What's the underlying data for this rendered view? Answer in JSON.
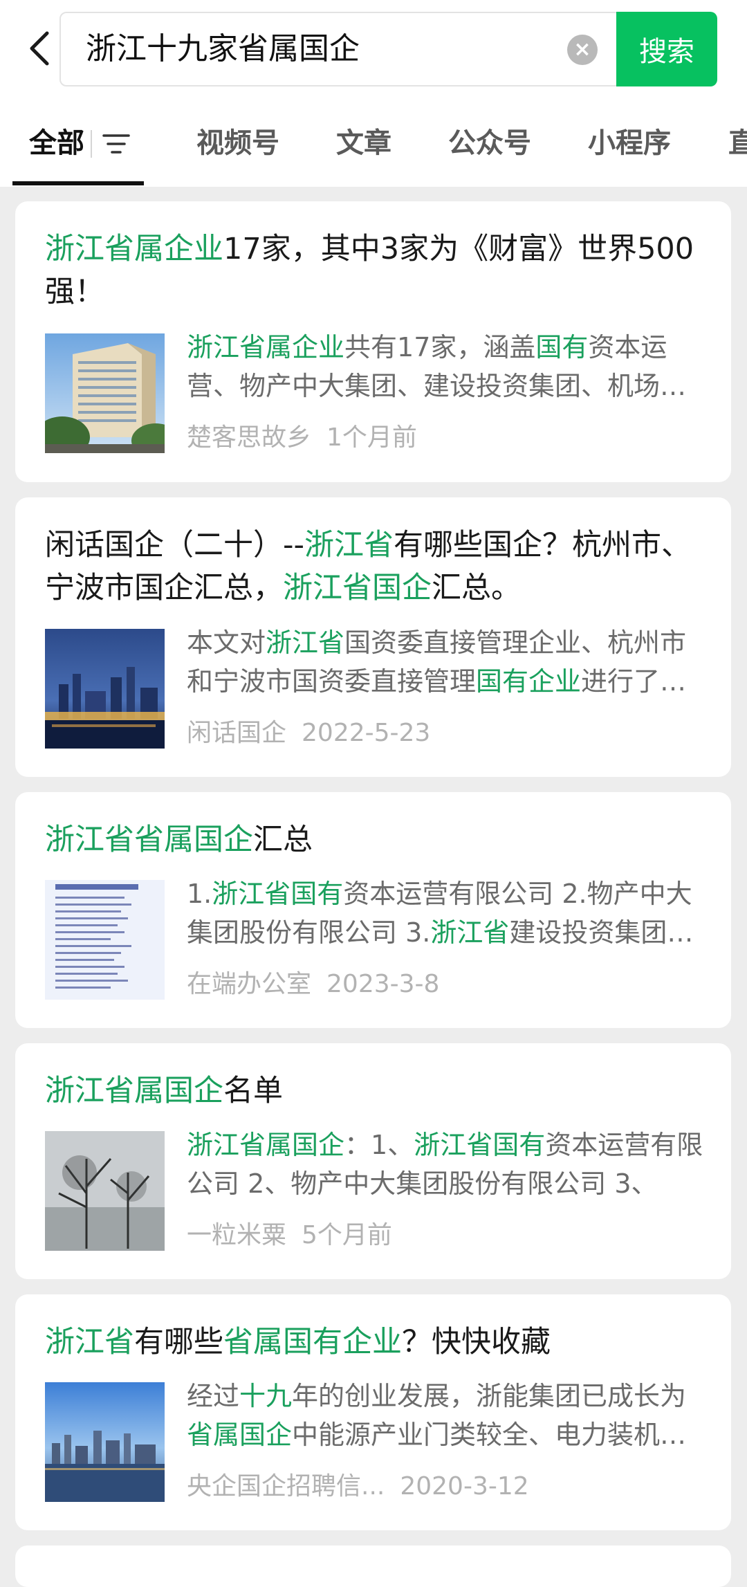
{
  "search": {
    "query": "浙江十九家省属国企",
    "clear_icon": "×",
    "button_label": "搜索"
  },
  "tabs": [
    "全部",
    "视频号",
    "文章",
    "公众号",
    "小程序",
    "直"
  ],
  "colors": {
    "accent": "#07c160",
    "highlight": "#1aa05d",
    "background": "#ededed"
  },
  "results": [
    {
      "title_parts": [
        [
          "浙江省属企业",
          true
        ],
        [
          "17家，其中3家为《财富》世界500强！",
          false
        ]
      ],
      "snippet_parts": [
        [
          "浙江省属企业",
          true
        ],
        [
          "共有17家，涵盖",
          false
        ],
        [
          "国有",
          true
        ],
        [
          "资本运营、物产中大集团、建设投资集团、机场集团、交通投资集团等",
          false
        ]
      ],
      "source": "楚客思故乡",
      "time": "1个月前",
      "thumb": "office-building-image"
    },
    {
      "title_parts": [
        [
          "闲话国企（二十）--",
          false
        ],
        [
          "浙江省",
          true
        ],
        [
          "有哪些国企？杭州市、宁波市国企汇总，",
          false
        ],
        [
          "浙江省国企",
          true
        ],
        [
          "汇总。",
          false
        ]
      ],
      "snippet_parts": [
        [
          "本文对",
          false
        ],
        [
          "浙江省",
          true
        ],
        [
          "国资委直接管理企业、杭州市和宁波市国资委直接管理",
          false
        ],
        [
          "国有企业",
          true
        ],
        [
          "进行了汇总整理",
          false
        ]
      ],
      "source": "闲话国企",
      "time": "2022-5-23",
      "thumb": "city-night-skyline-image"
    },
    {
      "title_parts": [
        [
          "浙江省省属国企",
          true
        ],
        [
          "汇总",
          false
        ]
      ],
      "snippet_parts": [
        [
          "1.",
          false
        ],
        [
          "浙江省国有",
          true
        ],
        [
          "资本运营有限公司 2.物产中大集团股份有限公司 3.",
          false
        ],
        [
          "浙江省",
          true
        ],
        [
          "建设投资集团股份有限公司",
          false
        ]
      ],
      "source": "在端办公室",
      "time": "2023-3-8",
      "thumb": "document-list-image"
    },
    {
      "title_parts": [
        [
          "浙江省属国企",
          true
        ],
        [
          "名单",
          false
        ]
      ],
      "snippet_parts": [
        [
          "浙江省属国企",
          true
        ],
        [
          "：1、",
          false
        ],
        [
          "浙江省国有",
          true
        ],
        [
          "资本运营有限公司 2、物产中大集团股份有限公司 3、",
          false
        ]
      ],
      "source": "一粒米粟",
      "time": "5个月前",
      "thumb": "bare-trees-image"
    },
    {
      "title_parts": [
        [
          "浙江省",
          true
        ],
        [
          "有哪些",
          false
        ],
        [
          "省属国有企业",
          true
        ],
        [
          "？快快收藏",
          false
        ]
      ],
      "snippet_parts": [
        [
          "经过",
          false
        ],
        [
          "十九",
          true
        ],
        [
          "年的创业发展，浙能集团已成长为",
          false
        ],
        [
          "省属国企",
          true
        ],
        [
          "中能源产业门类较全、电力装机规模最大的企业",
          false
        ]
      ],
      "source": "央企国企招聘信...",
      "time": "2020-3-12",
      "thumb": "waterfront-skyline-image"
    }
  ]
}
